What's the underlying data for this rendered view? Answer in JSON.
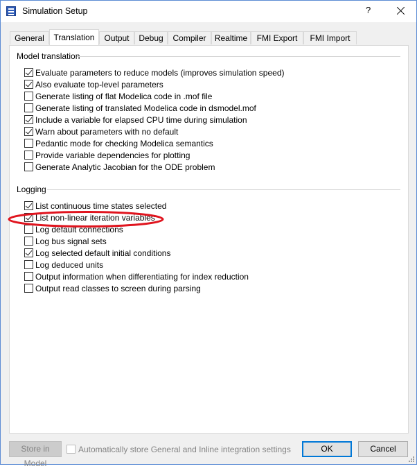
{
  "window": {
    "title": "Simulation Setup",
    "help_label": "?",
    "icon": "simulation-setup-icon"
  },
  "tabs": [
    {
      "label": "General",
      "active": false
    },
    {
      "label": "Translation",
      "active": true
    },
    {
      "label": "Output",
      "active": false
    },
    {
      "label": "Debug",
      "active": false
    },
    {
      "label": "Compiler",
      "active": false
    },
    {
      "label": "Realtime",
      "active": false
    },
    {
      "label": "FMI Export",
      "active": false
    },
    {
      "label": "FMI Import",
      "active": false
    }
  ],
  "model_translation": {
    "title": "Model translation",
    "items": [
      {
        "label": "Evaluate parameters to reduce models (improves simulation speed)",
        "checked": true
      },
      {
        "label": "Also evaluate top-level parameters",
        "checked": true
      },
      {
        "label": "Generate listing of flat Modelica code in .mof file",
        "checked": false
      },
      {
        "label": "Generate listing of translated Modelica code in dsmodel.mof",
        "checked": false
      },
      {
        "label": "Include a variable for elapsed CPU time during simulation",
        "checked": true
      },
      {
        "label": "Warn about parameters with no default",
        "checked": true
      },
      {
        "label": "Pedantic mode for checking Modelica semantics",
        "checked": false
      },
      {
        "label": "Provide variable dependencies for plotting",
        "checked": false
      },
      {
        "label": "Generate Analytic Jacobian for the ODE problem",
        "checked": false
      }
    ]
  },
  "logging": {
    "title": "Logging",
    "items": [
      {
        "label": "List continuous time states selected",
        "checked": true
      },
      {
        "label": "List non-linear iteration variables",
        "checked": true
      },
      {
        "label": "Log default connections",
        "checked": false
      },
      {
        "label": "Log bus signal sets",
        "checked": false
      },
      {
        "label": "Log selected default initial conditions",
        "checked": true
      },
      {
        "label": "Log deduced units",
        "checked": false
      },
      {
        "label": "Output information when differentiating for index reduction",
        "checked": false
      },
      {
        "label": "Output read classes to screen during parsing",
        "checked": false
      }
    ]
  },
  "footer": {
    "store_label": "Store in Model",
    "auto_store_label": "Automatically store General and Inline integration settings",
    "auto_store_checked": false,
    "ok_label": "OK",
    "cancel_label": "Cancel"
  },
  "colors": {
    "highlight_ellipse": "#e0141e",
    "accent": "#0078d7"
  }
}
